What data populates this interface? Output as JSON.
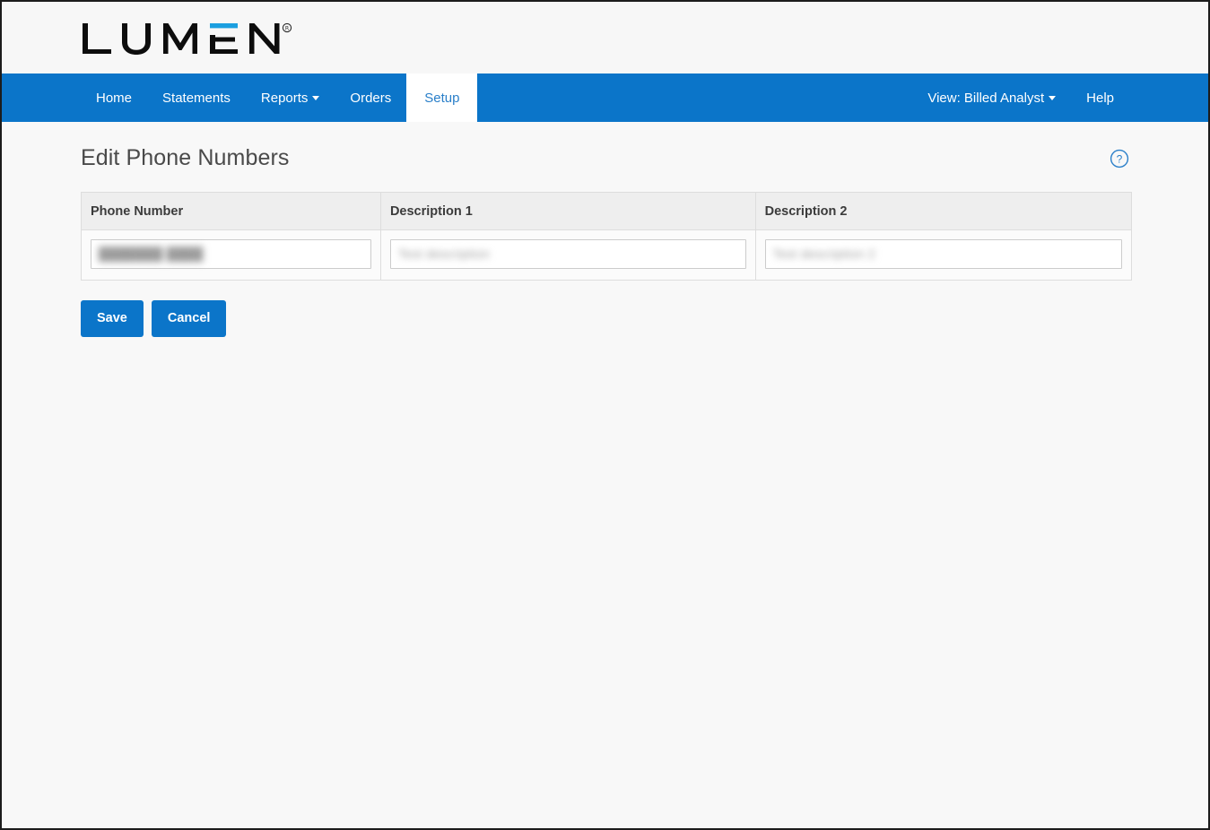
{
  "brand": {
    "logo_text": "LUMEN",
    "logo_registered_mark": "®",
    "accent_blue": "#0b75c9",
    "logo_black": "#0d0d0d"
  },
  "nav": {
    "left_items": [
      {
        "label": "Home",
        "active": false,
        "has_caret": false
      },
      {
        "label": "Statements",
        "active": false,
        "has_caret": false
      },
      {
        "label": "Reports",
        "active": false,
        "has_caret": true
      },
      {
        "label": "Orders",
        "active": false,
        "has_caret": false
      },
      {
        "label": "Setup",
        "active": true,
        "has_caret": false
      }
    ],
    "right_items": [
      {
        "label": "View: Billed Analyst",
        "has_caret": true
      },
      {
        "label": "Help",
        "has_caret": false
      }
    ]
  },
  "page": {
    "title": "Edit Phone Numbers",
    "help_icon": "question-mark-circle-icon",
    "help_icon_color": "#2a7fc9"
  },
  "table": {
    "columns": [
      "Phone Number",
      "Description 1",
      "Description 2"
    ],
    "rows": [
      {
        "phone_number": {
          "value": "███████ ████",
          "placeholder": "",
          "redacted": true
        },
        "description_1": {
          "value": "Test description",
          "placeholder": "",
          "redacted": true
        },
        "description_2": {
          "value": "Test description 2",
          "placeholder": "",
          "redacted": true
        }
      }
    ]
  },
  "actions": {
    "save_label": "Save",
    "cancel_label": "Cancel"
  }
}
